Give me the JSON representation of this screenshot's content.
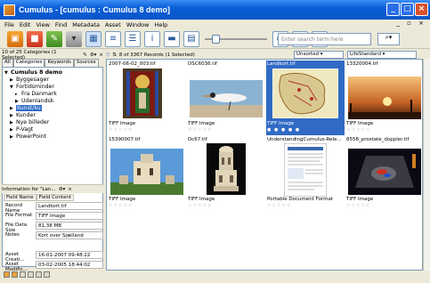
{
  "window": {
    "title": "Cumulus - [cumulus : Cumulus 8 demo]"
  },
  "menu": [
    "File",
    "Edit",
    "View",
    "Find",
    "Metadata",
    "Asset",
    "Window",
    "Help"
  ],
  "search": {
    "placeholder": "Enter search term here"
  },
  "left_panel": {
    "status": "10 of 25 Categories (1 Selected)",
    "tabs": [
      "All",
      "Categories",
      "Keywords",
      "Sources"
    ],
    "tree": [
      {
        "label": "Cumulus 8 demo",
        "level": 0,
        "twisty": "▼",
        "bold": true
      },
      {
        "label": "Byggesager",
        "level": 1,
        "twisty": "▶"
      },
      {
        "label": "Fortidsminder",
        "level": 1,
        "twisty": "▼"
      },
      {
        "label": "Fra Danmark",
        "level": 2,
        "twisty": "▸"
      },
      {
        "label": "Udenlandsk",
        "level": 2,
        "twisty": "▶"
      },
      {
        "label": "Kunst/ku",
        "level": 1,
        "twisty": "▶",
        "selected": true
      },
      {
        "label": "Kunder",
        "level": 1,
        "twisty": "▶"
      },
      {
        "label": "Nye billeder",
        "level": 1,
        "twisty": "▶"
      },
      {
        "label": "P-Vagt",
        "level": 1,
        "twisty": "▶"
      },
      {
        "label": "PowerPoint",
        "level": 1,
        "twisty": "▶"
      }
    ],
    "info": {
      "header": "Information for \"Lan...",
      "col_field_name": "Field Name",
      "col_field_content": "Field Content",
      "rows": [
        {
          "key": "Record Name",
          "value": "Landkort.tif"
        },
        {
          "key": "File Format",
          "value": "TIFF Image"
        },
        {
          "key": "File Data Size",
          "value": "81,38 MB"
        },
        {
          "key": "Notes",
          "value": "Kort over Sjælland"
        },
        {
          "key": "Asset Creati...",
          "value": "16-01-2007 09:48:22"
        },
        {
          "key": "Asset Modific...",
          "value": "03-02-2005 18:44:02"
        }
      ]
    }
  },
  "right_panel": {
    "status": "8 of 3367 Records (1 Selected)",
    "sort1": "Unsorted",
    "sort2": "LifeStandard",
    "records": [
      {
        "name": "2007-06-02_003.tif",
        "type": "TIFF Image",
        "rating": "☆☆☆☆☆",
        "thumb": "stained-glass"
      },
      {
        "name": "DSC6036.tif",
        "type": "TIFF Image",
        "rating": "☆☆☆☆☆",
        "thumb": "bird"
      },
      {
        "name": "Landkort.tif",
        "type": "TIFF Image",
        "rating": "● ● ● ● ●",
        "thumb": "map",
        "selected": true
      },
      {
        "name": "13320004.tif",
        "type": "TIFF Image",
        "rating": "☆☆☆☆☆",
        "thumb": "sunset"
      },
      {
        "name": "15390007.tif",
        "type": "TIFF Image",
        "rating": "☆☆☆☆☆",
        "thumb": "ruin"
      },
      {
        "name": "Dc67.tif",
        "type": "TIFF Image",
        "rating": "☆☆☆☆☆",
        "thumb": "ivory-tower"
      },
      {
        "name": "UnderstandingCumulus-Rele...",
        "type": "Portable Document Format",
        "rating": "☆☆☆☆☆",
        "thumb": "document"
      },
      {
        "name": "8558_prostate_doppler.tif",
        "type": "TIFF Image",
        "rating": "☆☆☆☆☆",
        "thumb": "ultrasound"
      }
    ]
  }
}
